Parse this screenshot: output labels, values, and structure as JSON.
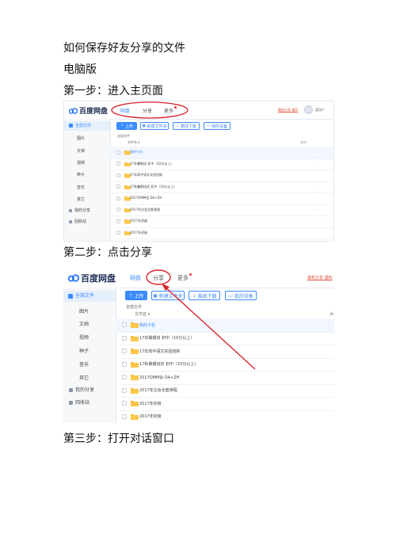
{
  "doc": {
    "title": "如何保存好友分享的文件",
    "subtitle": "电脑版",
    "step1": "第一步：进入主页面",
    "step2": "第二步：点击分享",
    "step3": "第三步：打开对话窗口"
  },
  "app": {
    "logo": "百度网盘",
    "nav": [
      "网盘",
      "分享",
      "更多"
    ],
    "right_link": "最新分享 福利",
    "username": "某用户",
    "sidebar": [
      "全部文件",
      "图片",
      "文档",
      "视频",
      "种子",
      "音乐",
      "其它",
      "我的分享",
      "回收站"
    ],
    "toolbar": {
      "upload": "上传",
      "new_folder": "新建文件夹",
      "download": "离线下载",
      "device": "我的设备"
    },
    "breadcrumb": "全部文件",
    "col_name": "文件名",
    "col_size": "大小",
    "files": [
      "我的卡包",
      "17年暑期班 初中（10分以上）",
      "17年高中语文实验班新",
      "17秋暑期班初 初中（10分以上）",
      "2017OMM会 DA+ZH",
      "2017年注会全套课程",
      "2017年初级",
      "2017年初级"
    ],
    "size_dash": "-"
  }
}
